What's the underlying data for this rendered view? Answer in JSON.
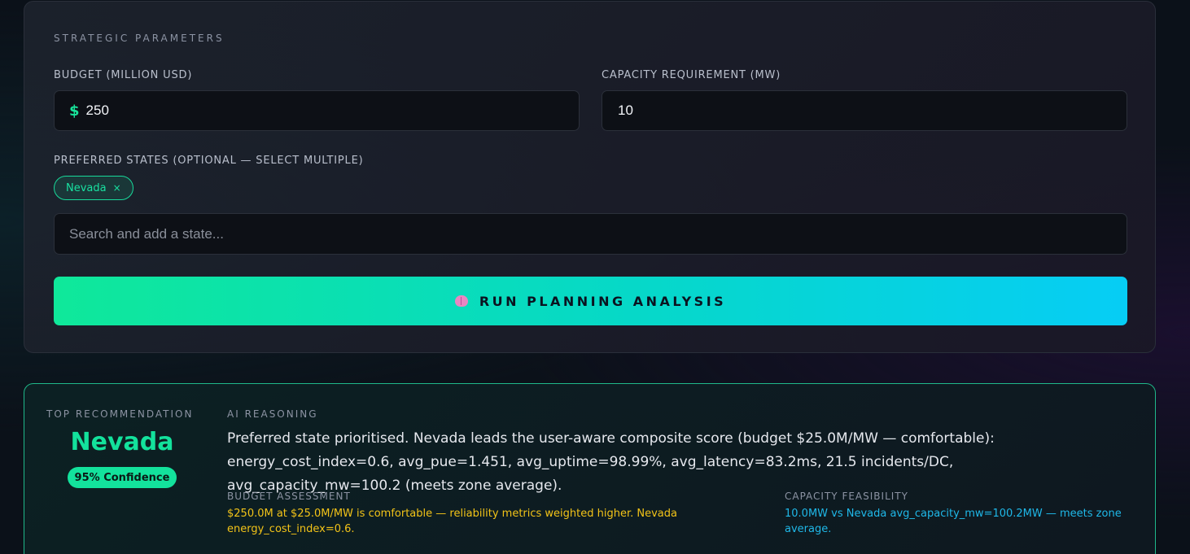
{
  "params": {
    "section_title": "STRATEGIC PARAMETERS",
    "budget_label": "BUDGET (MILLION USD)",
    "budget_currency": "$",
    "budget_value": "250",
    "capacity_label": "CAPACITY REQUIREMENT (MW)",
    "capacity_value": "10",
    "states_label": "PREFERRED STATES (OPTIONAL — SELECT MULTIPLE)",
    "selected_states": [
      {
        "name": "Nevada",
        "remove": "×"
      }
    ],
    "search_placeholder": "Search and add a state...",
    "run_button_label": "RUN PLANNING ANALYSIS",
    "run_button_icon": "brain-icon"
  },
  "result": {
    "top_label": "TOP RECOMMENDATION",
    "state": "Nevada",
    "confidence": "95% Confidence",
    "reasoning_label": "AI REASONING",
    "reasoning_text": "Preferred state prioritised. Nevada leads the user-aware composite score (budget $25.0M/MW — comfortable): energy_cost_index=0.6, avg_pue=1.451, avg_uptime=98.99%, avg_latency=83.2ms, 21.5 incidents/DC, avg_capacity_mw=100.2 (meets zone average).",
    "budget_label": "BUDGET ASSESSMENT",
    "budget_text": "$250.0M at $25.0M/MW is comfortable — reliability metrics weighted higher. Nevada energy_cost_index=0.6.",
    "capacity_label": "CAPACITY FEASIBILITY",
    "capacity_text": "10.0MW vs Nevada avg_capacity_mw=100.2MW — meets zone average."
  },
  "colors": {
    "accent_green": "#13e29c",
    "accent_cyan": "#06cdf5",
    "budget_text": "#f2c318",
    "capacity_text": "#1fb8e8"
  }
}
